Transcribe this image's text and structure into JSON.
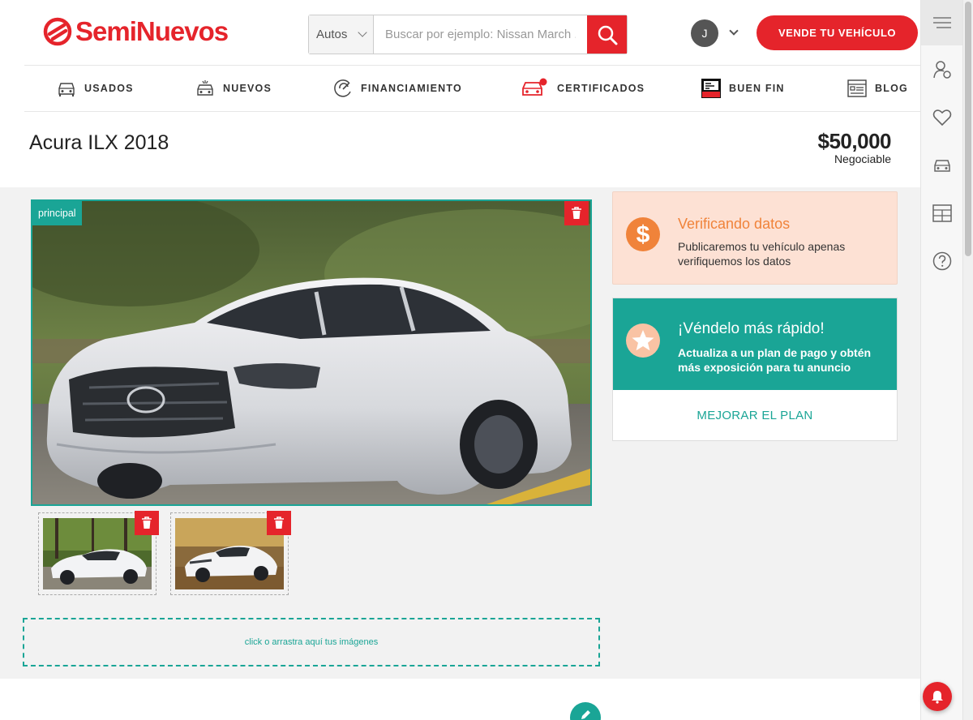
{
  "brand": {
    "name": "SemiNuevos",
    "accent": "#e5242b",
    "teal": "#1aa596"
  },
  "search": {
    "category": "Autos",
    "placeholder": "Buscar por ejemplo: Nissan March ..."
  },
  "user": {
    "initial": "J"
  },
  "header": {
    "sell_button": "VENDE TU VEHÍCULO"
  },
  "nav": {
    "items": [
      {
        "label": "USADOS",
        "icon": "car-icon"
      },
      {
        "label": "NUEVOS",
        "icon": "new-car-icon"
      },
      {
        "label": "FINANCIAMIENTO",
        "icon": "financing-icon"
      },
      {
        "label": "CERTIFICADOS",
        "icon": "certified-car-icon"
      },
      {
        "label": "BUEN FIN",
        "icon": "buen-fin-icon"
      },
      {
        "label": "BLOG",
        "icon": "blog-icon"
      }
    ]
  },
  "rail": {
    "icons": [
      "menu-icon",
      "user-settings-icon",
      "heart-icon",
      "car-icon",
      "dashboard-icon",
      "help-icon"
    ]
  },
  "listing": {
    "title": "Acura ILX 2018",
    "price": "$50,000",
    "price_note": "Negociable"
  },
  "photos": {
    "main_badge": "principal",
    "dropzone_text": "click o arrastra aquí tus imágenes"
  },
  "verify_card": {
    "title": "Verificando datos",
    "text": "Publicaremos tu vehículo apenas verifiquemos los datos"
  },
  "plan_card": {
    "title": "¡Véndelo más rápido!",
    "text": "Actualiza a un plan de pago y obtén más exposición para tu anuncio",
    "link": "MEJORAR EL PLAN"
  }
}
